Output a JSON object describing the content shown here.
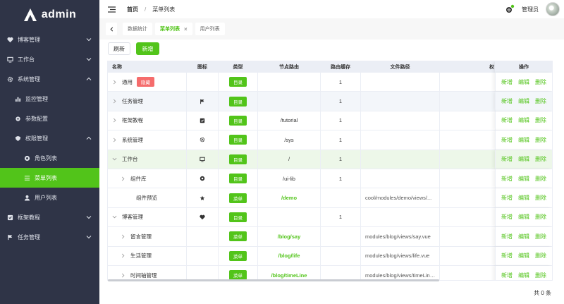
{
  "app": {
    "name": "admin"
  },
  "sidebar": {
    "items": [
      {
        "label": "博客管理",
        "icon": "heart-icon"
      },
      {
        "label": "工作台",
        "icon": "monitor-icon"
      },
      {
        "label": "系统管理",
        "icon": "gear-icon"
      },
      {
        "label": "监控管理",
        "icon": "bar-chart-icon"
      },
      {
        "label": "参数配置",
        "icon": "settings-icon"
      },
      {
        "label": "权限管理",
        "icon": "shield-icon"
      },
      {
        "label": "角色列表",
        "icon": "circle-dot-icon"
      },
      {
        "label": "菜单列表",
        "icon": "menu-list-icon"
      },
      {
        "label": "用户列表",
        "icon": "user-icon"
      },
      {
        "label": "框架教程",
        "icon": "check-square-icon"
      },
      {
        "label": "任务管理",
        "icon": "flag-icon"
      }
    ]
  },
  "header": {
    "breadcrumb": [
      "首页",
      "菜单列表"
    ],
    "separator": "/",
    "user_name": "管理员"
  },
  "tabs": [
    {
      "label": "数据统计"
    },
    {
      "label": "菜单列表"
    },
    {
      "label": "用户列表"
    }
  ],
  "toolbar": {
    "refresh_label": "刷新",
    "add_label": "新增"
  },
  "table": {
    "columns": {
      "name": "名称",
      "icon": "图标",
      "type": "类型",
      "route": "节点路由",
      "keep": "路由缓存",
      "path": "文件路径",
      "extra": "权",
      "ops": "操作"
    },
    "ops_labels": {
      "add": "新增",
      "edit": "编辑",
      "delete": "删除"
    },
    "rows": [
      {
        "name": "通用",
        "hidden_tag": "隐藏",
        "icon": "",
        "type": "目录",
        "route": "",
        "keep": "1",
        "path": ""
      },
      {
        "name": "任务管理",
        "icon": "flag-icon",
        "type": "目录",
        "route": "",
        "keep": "1",
        "path": ""
      },
      {
        "name": "框架教程",
        "icon": "check-square-icon",
        "type": "目录",
        "route": "/tutorial",
        "keep": "1",
        "path": ""
      },
      {
        "name": "系统管理",
        "icon": "gear-icon",
        "type": "目录",
        "route": "/sys",
        "keep": "1",
        "path": ""
      },
      {
        "name": "工作台",
        "icon": "monitor-icon",
        "type": "目录",
        "route": "/",
        "keep": "1",
        "path": ""
      },
      {
        "name": "组件库",
        "icon": "circle-dot-icon",
        "type": "目录",
        "route": "/ui-lib",
        "keep": "1",
        "path": ""
      },
      {
        "name": "组件预览",
        "icon": "star-icon",
        "type": "菜单",
        "route": "/demo",
        "keep": "",
        "path": "cool/modules/demo/views/..."
      },
      {
        "name": "博客管理",
        "icon": "heart-icon",
        "type": "目录",
        "route": "",
        "keep": "1",
        "path": ""
      },
      {
        "name": "留言管理",
        "icon": "",
        "type": "菜单",
        "route": "/blog/say",
        "keep": "",
        "path": "modules/blog/views/say.vue"
      },
      {
        "name": "生活管理",
        "icon": "",
        "type": "菜单",
        "route": "/blog/life",
        "keep": "",
        "path": "modules/blog/views/life.vue"
      },
      {
        "name": "时间轴管理",
        "icon": "",
        "type": "菜单",
        "route": "/blog/timeLine",
        "keep": "",
        "path": "modules/blog/views/timeLine.vue"
      }
    ],
    "total": "共 0 条"
  },
  "colors": {
    "primary": "#52c41a",
    "danger": "#f56c6c",
    "sidebar_bg": "#2f3447"
  }
}
